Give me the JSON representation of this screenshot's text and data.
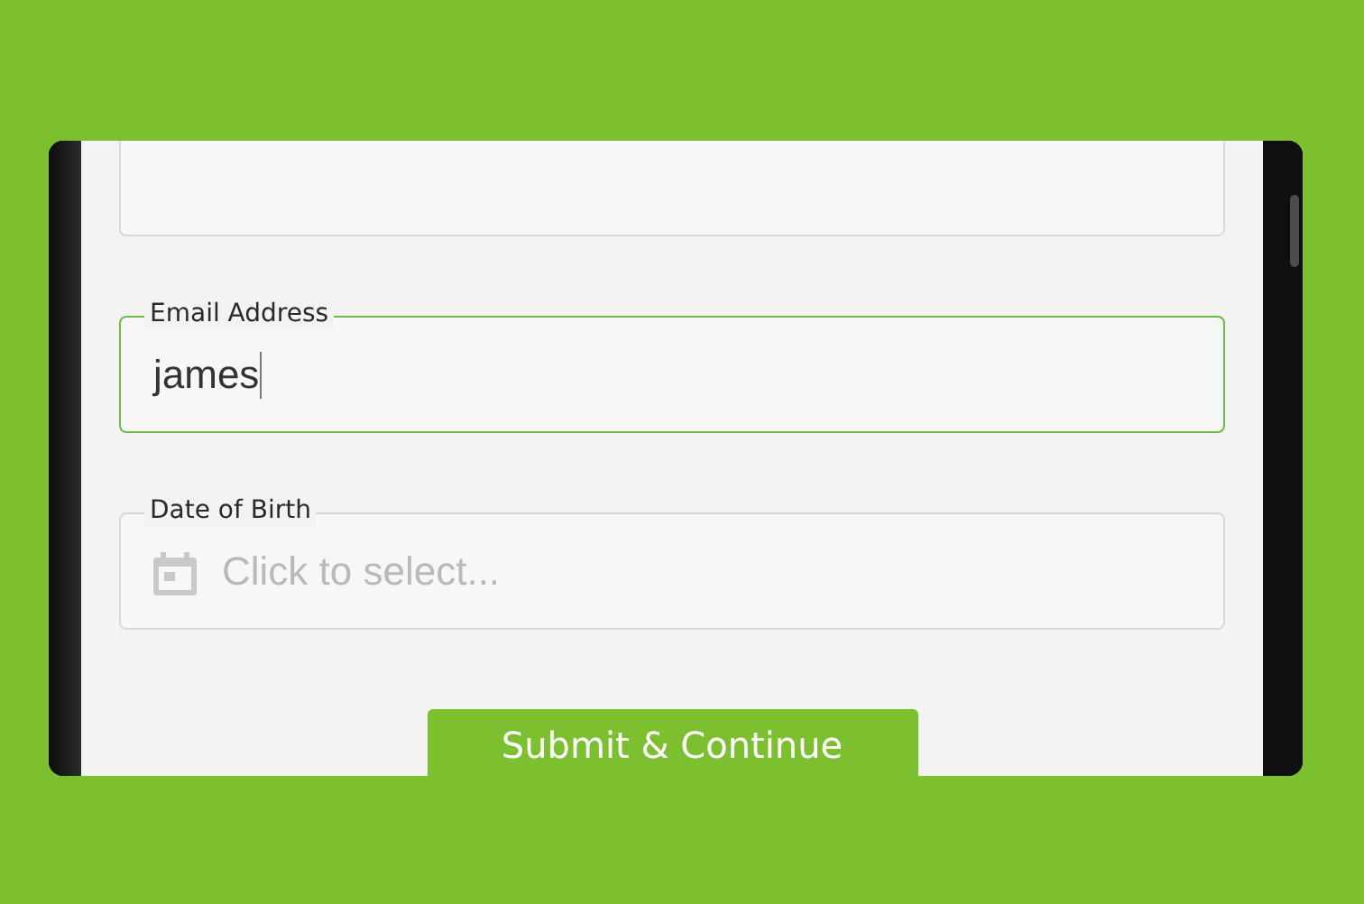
{
  "form": {
    "fields": [
      {
        "kind": "text",
        "focused": false
      },
      {
        "kind": "text",
        "label": "Email Address",
        "value": "james",
        "focused": true
      },
      {
        "kind": "date",
        "label": "Date of Birth",
        "placeholder": "Click to select...",
        "focused": false
      }
    ],
    "submit_button": "Submit & Continue"
  }
}
